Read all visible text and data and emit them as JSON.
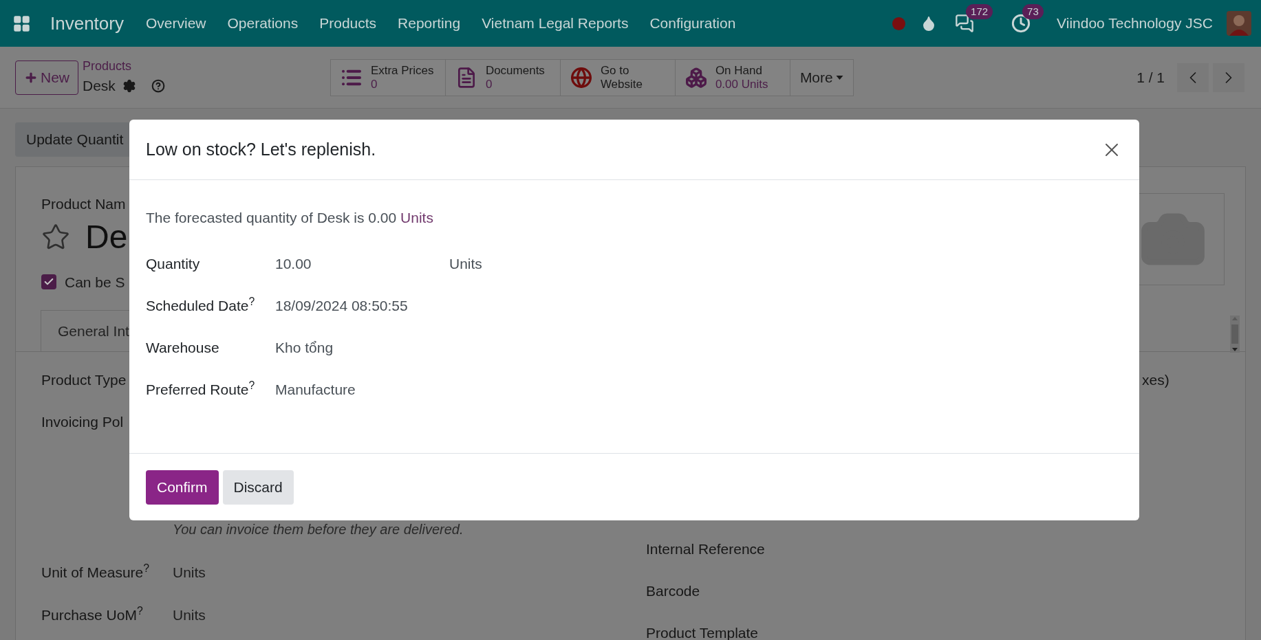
{
  "navbar": {
    "app": "Inventory",
    "menu": [
      "Overview",
      "Operations",
      "Products",
      "Reporting",
      "Vietnam Legal Reports",
      "Configuration"
    ],
    "badges": [
      {
        "kind": "chat",
        "count": "172"
      },
      {
        "kind": "activity",
        "count": "73"
      }
    ],
    "company": "Viindoo Technology JSC"
  },
  "control_panel": {
    "new_button": "New",
    "breadcrumb": "Products",
    "record": "Desk",
    "stat_buttons": [
      {
        "kind": "list",
        "label": "Extra Prices",
        "value": "0"
      },
      {
        "kind": "document",
        "label": "Documents",
        "value": "0"
      },
      {
        "kind": "globe",
        "label": "Go to Website"
      },
      {
        "kind": "boxes",
        "label": "On Hand",
        "value": "0.00 Units"
      }
    ],
    "more": "More",
    "pager": "1 / 1"
  },
  "form": {
    "action_button": "Update Quantit",
    "name_label": "Product Nam",
    "name": "De",
    "favorite": false,
    "checkbox": {
      "label": "Can be S",
      "checked": true
    },
    "tab": {
      "label": "General Int",
      "selected": true
    },
    "left_fields": [
      "Product Type",
      "Invoicing Pol"
    ],
    "note": "You can invoice them before they are delivered.",
    "lower_fields": [
      {
        "label": "Unit of Measure$^{?}$",
        "value": "Units"
      },
      {
        "label": "Purchase UoM$^{?}$",
        "value": "Units"
      }
    ],
    "right_fragment": "xes)",
    "right_fields": [
      "Internal Reference",
      "Barcode",
      "Product Template"
    ]
  },
  "dialog": {
    "title": "Low on stock? Let's replenish.",
    "message": "The forecasted quantity of Desk is 0.00",
    "message_link": "Units",
    "fields": [
      {
        "label": "Quantity",
        "value": "10.00",
        "unit": "Units"
      },
      {
        "label": "Scheduled Date$^{?}$",
        "value": "18/09/2024 08:50:55"
      },
      {
        "label": "Warehouse",
        "value": "Kho tổng"
      },
      {
        "label": "Preferred Route$^{?}$",
        "value": "Manufacture"
      }
    ],
    "buttons": [
      {
        "kind": "primary",
        "label": "Confirm"
      },
      {
        "kind": "secondary",
        "label": "Discard"
      }
    ]
  }
}
